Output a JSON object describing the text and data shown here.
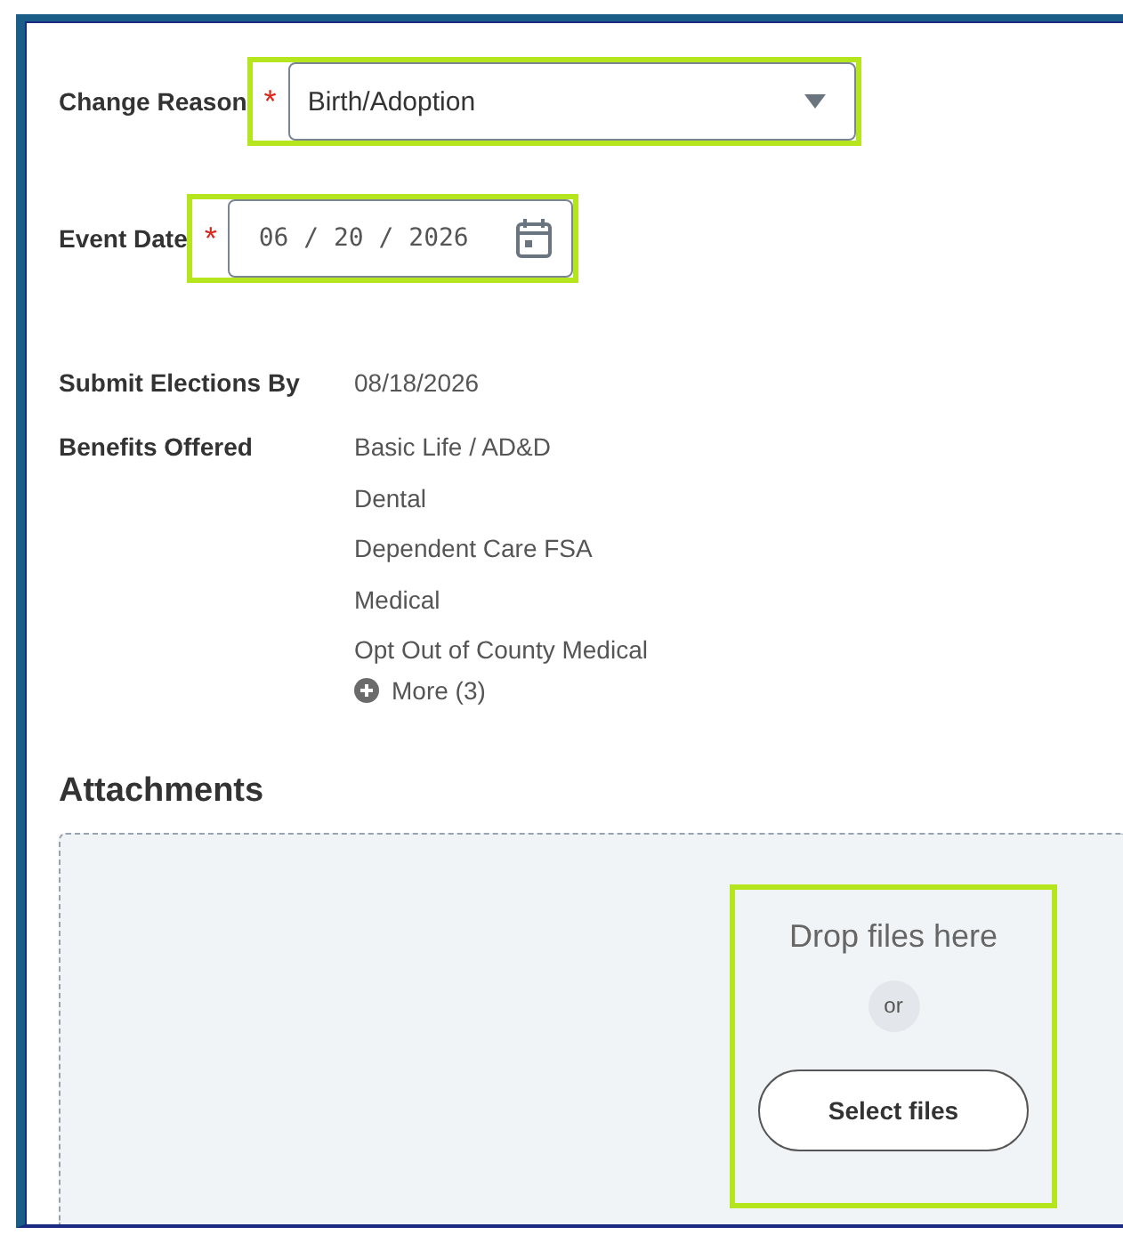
{
  "fields": [
    {
      "kind": "select",
      "label": "Change Reason",
      "required_mark": "*",
      "value": "Birth/Adoption",
      "highlighted": true
    },
    {
      "kind": "date",
      "label": "Event Date",
      "required_mark": "*",
      "value": "06 / 20 / 2026",
      "highlighted": true
    }
  ],
  "submit_elections_by": {
    "label": "Submit Elections By",
    "value": "08/18/2026"
  },
  "benefits_offered": {
    "label": "Benefits Offered",
    "items": [
      "Basic Life / AD&D",
      "Dental",
      "Dependent Care FSA",
      "Medical",
      "Opt Out of County Medical"
    ],
    "more": "More (3)"
  },
  "attachments": {
    "title": "Attachments",
    "drop_text": "Drop files here",
    "or": "or",
    "button": "Select files",
    "highlighted": true
  }
}
